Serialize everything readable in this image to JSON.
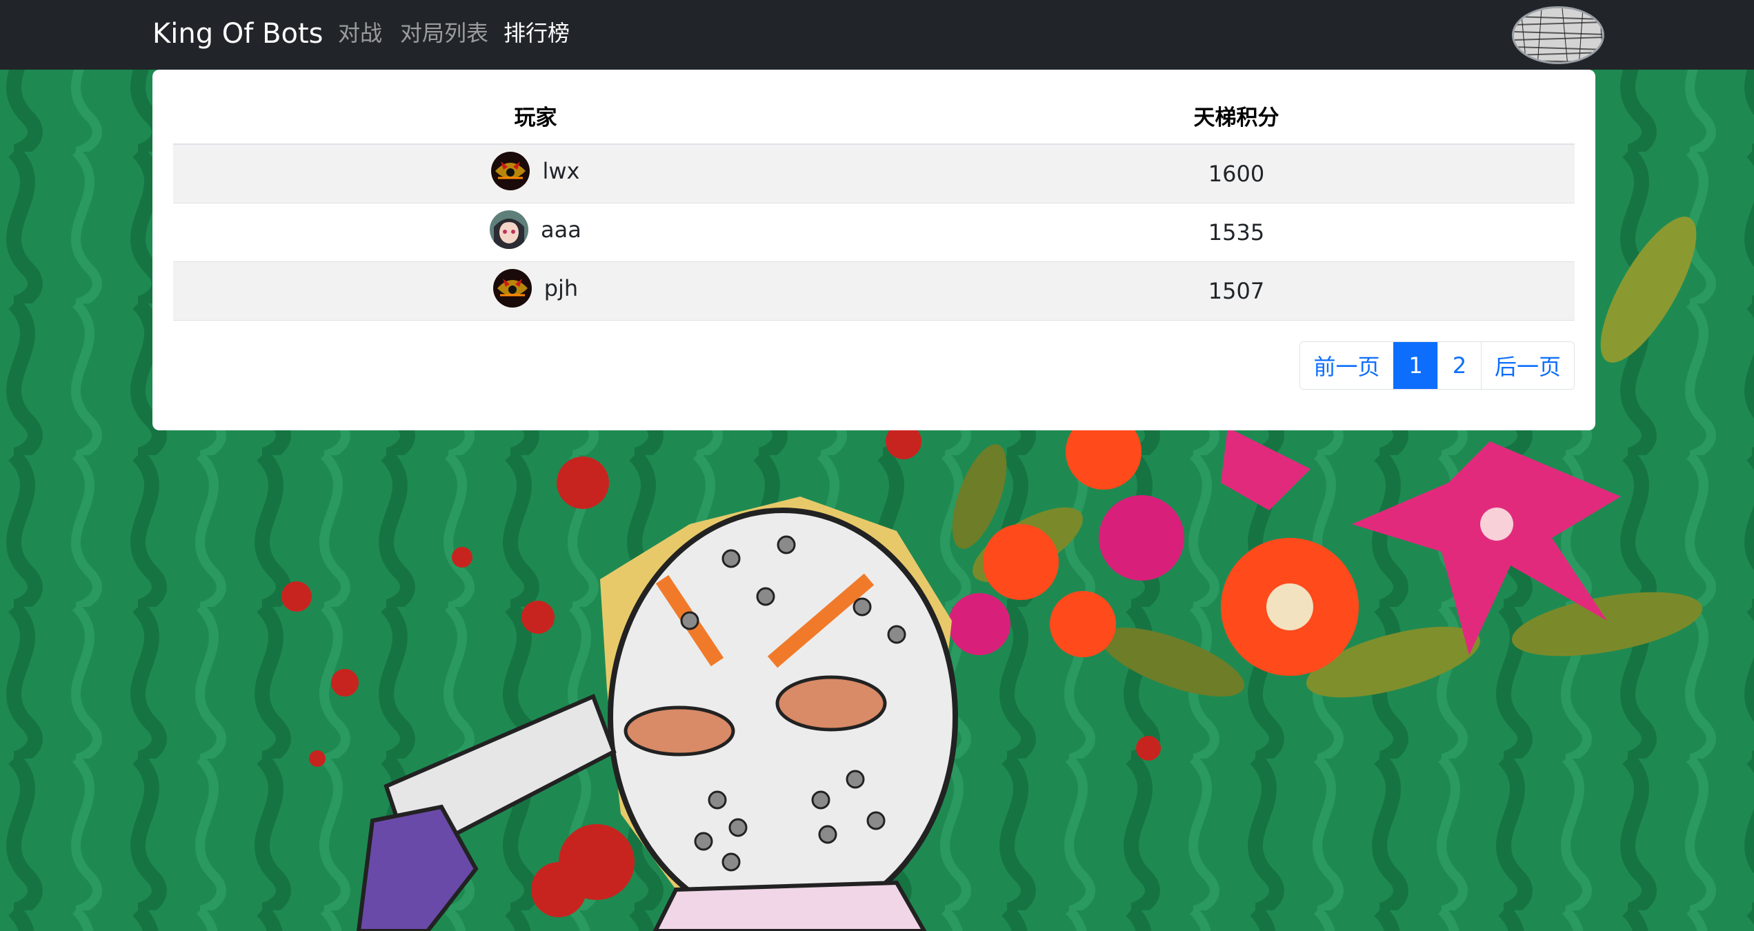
{
  "navbar": {
    "brand": "King Of Bots",
    "links": [
      {
        "label": "对战",
        "active": false
      },
      {
        "label": "对局列表",
        "active": false
      },
      {
        "label": "排行榜",
        "active": true
      }
    ],
    "user_avatar_icon": "user-avatar"
  },
  "ranklist": {
    "headers": {
      "player": "玩家",
      "rating": "天梯积分"
    },
    "rows": [
      {
        "username": "lwx",
        "rating": "1600",
        "avatar_icon": "dark-red-avatar"
      },
      {
        "username": "aaa",
        "rating": "1535",
        "avatar_icon": "anime-girl-avatar"
      },
      {
        "username": "pjh",
        "rating": "1507",
        "avatar_icon": "dark-red-avatar"
      }
    ]
  },
  "pagination": {
    "prev": "前一页",
    "pages": [
      "1",
      "2"
    ],
    "current_page": "1",
    "next": "后一页"
  },
  "colors": {
    "navbar_bg": "#212529",
    "accent": "#0d6efd",
    "background_green": "#1e8a52"
  }
}
